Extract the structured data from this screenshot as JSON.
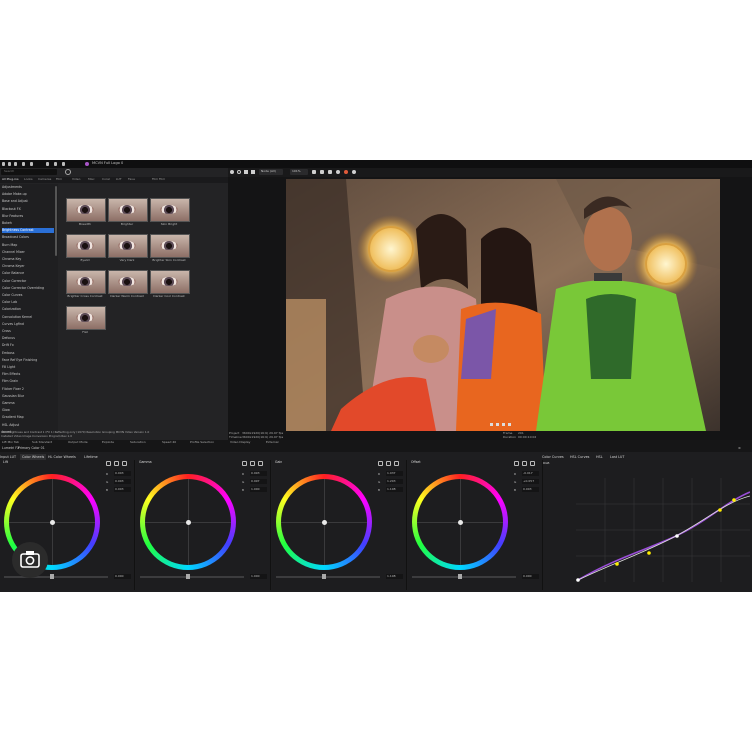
{
  "window": {
    "title": "MCVN Full Logo 0"
  },
  "toolbar": {
    "zoom": "101%",
    "clip_label": "Node (All)"
  },
  "browser": {
    "search_placeholder": "Search",
    "tabs": [
      "All Plug-ins",
      "Looks",
      "Cameras",
      "Film",
      "Video",
      "Misc",
      "Coral",
      "LUT",
      "Fave",
      "Film Film"
    ],
    "categories": [
      "Adjustments",
      "Adobe Make-up",
      "Base and Adjust",
      "Blackout FX",
      "Blur Features",
      "Bokeh",
      "Brightness Contrast",
      "Broadcast Colors",
      "Burn Map",
      "Channel Mixer",
      "Chroma Key",
      "Chroma Keyer",
      "Color Balance",
      "Color Corrector",
      "Color Corrector Overriding",
      "Color Curves",
      "Color Lab",
      "Colorization",
      "Convolution Kernel",
      "Curves Lgfind",
      "Cross",
      "Defocus",
      "Drift Fx",
      "Emboss",
      "Face Ref Eye Finishing",
      "Fill Light",
      "Film Effects",
      "Film Grain",
      "Flicker Fixer 2",
      "Gaussian Blur",
      "Gamma",
      "Glow",
      "Gradient Map",
      "HSL Adjust",
      "Invert"
    ],
    "selected_index": 6,
    "thumbnails": [
      "Breadth",
      "Brighter",
      "Skin Bright",
      "Eyelid",
      "Very Dark",
      "Brighter Skin Contrast",
      "Brighter Cross Contrast",
      "Darker Warm Contrast",
      "Darker Cool Contrast",
      "Flat"
    ],
    "status_lines": [
      "DRX Brightness and Contrast 1 (FX 1) Reflecting only (1970) Resolution Grouping MCVN Video Version 1.0",
      "Installed Video Image Conversion Program Rev 1.0"
    ],
    "bottom_tabs": [
      "Lift Mix Tab",
      "Sub Standard",
      "Output Mode",
      "Explode",
      "Saturation",
      "Speed 40",
      "Profile Selection"
    ]
  },
  "viewer": {
    "info_left": [
      "Project",
      "Timeline"
    ],
    "info_left_vals": [
      "3600x1920(16:9) 29.97 fps",
      "3600x1920(16:9) 29.97 fps"
    ],
    "info_right": [
      "Frame",
      "Duration"
    ],
    "info_right_vals": [
      "201",
      "00:00:10:02"
    ],
    "bottom_bar": [
      "Video Display",
      "External"
    ]
  },
  "color_panel": {
    "header": [
      "Lumetri FX",
      "Primary Color 01"
    ],
    "tabs": [
      "Input LUT",
      "Color Wheels",
      "HL Color Wheels",
      "Lifetime"
    ],
    "curves_tabs": [
      "Color Curves",
      "HSL Curves",
      "HSL",
      "Last LUT"
    ],
    "curves_label": "RGB",
    "wheels": [
      {
        "name": "Lift",
        "r": "0.003",
        "g": "0.003",
        "b": "0.003",
        "bottom": "0.000"
      },
      {
        "name": "Gamma",
        "r": "0.993",
        "g": "0.997",
        "b": "1.000",
        "bottom": "1.000"
      },
      {
        "name": "Gain",
        "r": "1.037",
        "g": "1.203",
        "b": "1.108",
        "bottom": "1.108"
      },
      {
        "name": "Offset",
        "r": "-0.017",
        "g": "+0.057",
        "b": "0.003",
        "bottom": "0.000"
      }
    ]
  },
  "accent": "#2a6fd6"
}
